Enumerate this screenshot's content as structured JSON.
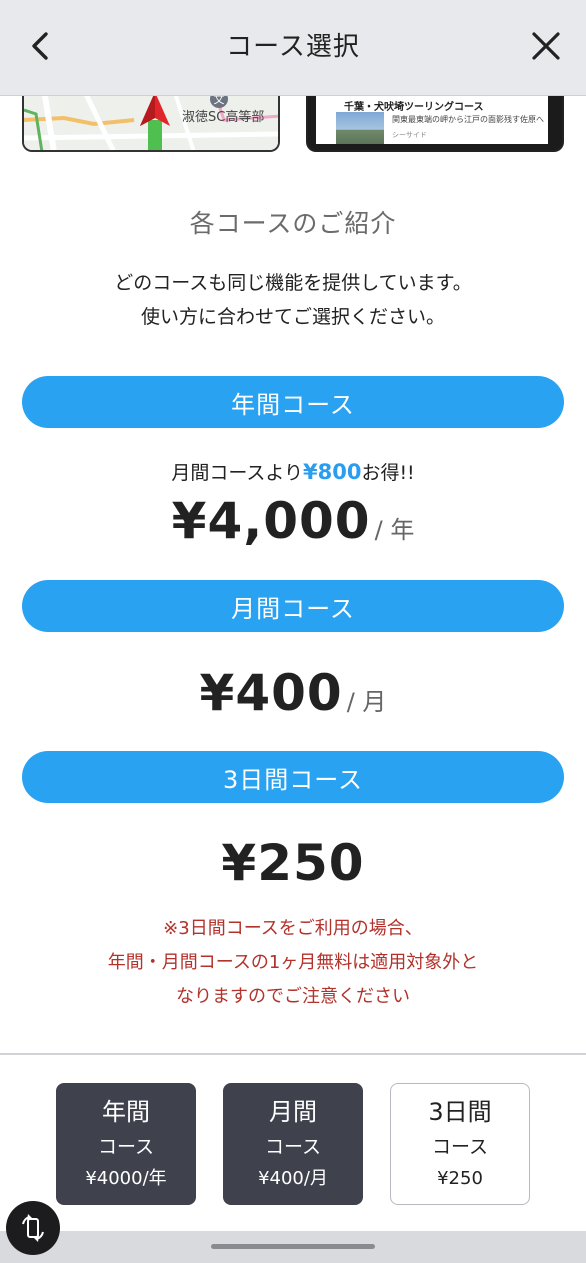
{
  "header": {
    "title": "コース選択",
    "back_icon": "chevron-left-icon",
    "close_icon": "close-icon"
  },
  "previews": {
    "map": {
      "label": "淑徳SC高等部",
      "school_glyph": "文"
    },
    "route": {
      "title": "千葉・犬吠埼ツーリングコース",
      "description": "関東最東端の岬から江戸の面影残す佐原へ",
      "tag": "シーサイド"
    }
  },
  "intro": {
    "title": "各コースのご紹介",
    "line1": "どのコースも同じ機能を提供しています。",
    "line2": "使い方に合わせてご選択ください。"
  },
  "courses": [
    {
      "label": "年間コース",
      "savings_prefix": "月間コースより",
      "savings_amount": "¥800",
      "savings_suffix": "お得!!",
      "price": "¥4,000",
      "unit": "/ 年"
    },
    {
      "label": "月間コース",
      "price": "¥400",
      "unit": "/ 月"
    },
    {
      "label": "3日間コース",
      "price": "¥250"
    }
  ],
  "notice": {
    "line1": "※3日間コースをご利用の場合、",
    "line2": "年間・月間コースの1ヶ月無料は適用対象外と",
    "line3": "なりますのでご注意ください"
  },
  "plan_buttons": [
    {
      "line1": "年間",
      "line2": "コース",
      "line3": "¥4000/年"
    },
    {
      "line1": "月間",
      "line2": "コース",
      "line3": "¥400/月"
    },
    {
      "line1": "3日間",
      "line2": "コース",
      "line3": "¥250"
    }
  ],
  "colors": {
    "accent": "#29a2f2",
    "notice": "#b3322c",
    "dark_button": "#3f424d"
  }
}
